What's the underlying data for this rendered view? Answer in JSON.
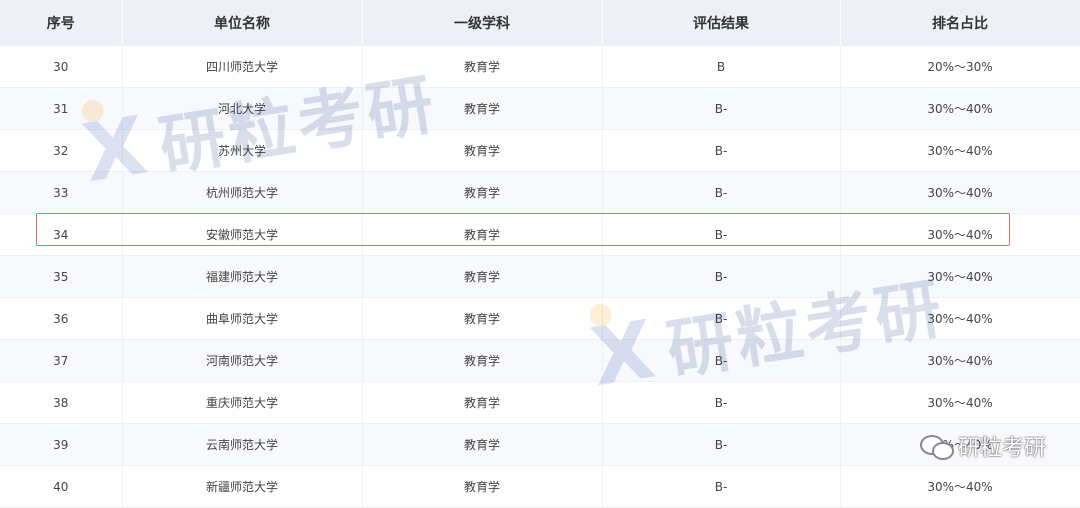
{
  "table": {
    "headers": [
      "序号",
      "单位名称",
      "一级学科",
      "评估结果",
      "排名占比"
    ],
    "rows": [
      {
        "no": "30",
        "name": "四川师范大学",
        "subject": "教育学",
        "result": "B",
        "ratio": "20%～30%"
      },
      {
        "no": "31",
        "name": "河北大学",
        "subject": "教育学",
        "result": "B-",
        "ratio": "30%～40%"
      },
      {
        "no": "32",
        "name": "苏州大学",
        "subject": "教育学",
        "result": "B-",
        "ratio": "30%～40%"
      },
      {
        "no": "33",
        "name": "杭州师范大学",
        "subject": "教育学",
        "result": "B-",
        "ratio": "30%～40%"
      },
      {
        "no": "34",
        "name": "安徽师范大学",
        "subject": "教育学",
        "result": "B-",
        "ratio": "30%～40%"
      },
      {
        "no": "35",
        "name": "福建师范大学",
        "subject": "教育学",
        "result": "B-",
        "ratio": "30%～40%"
      },
      {
        "no": "36",
        "name": "曲阜师范大学",
        "subject": "教育学",
        "result": "B-",
        "ratio": "30%～40%"
      },
      {
        "no": "37",
        "name": "河南师范大学",
        "subject": "教育学",
        "result": "B-",
        "ratio": "30%～40%"
      },
      {
        "no": "38",
        "name": "重庆师范大学",
        "subject": "教育学",
        "result": "B-",
        "ratio": "30%～40%"
      },
      {
        "no": "39",
        "name": "云南师范大学",
        "subject": "教育学",
        "result": "B-",
        "ratio": "30%～40%"
      },
      {
        "no": "40",
        "name": "新疆师范大学",
        "subject": "教育学",
        "result": "B-",
        "ratio": "30%～40%"
      }
    ],
    "highlighted_row": "34"
  },
  "watermark": {
    "text": "研粒考研",
    "icon": "x-logo-icon"
  },
  "wechat_badge": {
    "text": "研粒考研",
    "icon": "wechat-icon"
  },
  "colors": {
    "header_bg": "#eef0f7",
    "highlight_border": "#e36b6b",
    "watermark": "#1e3a8a",
    "watermark_dot": "#f39c12"
  }
}
